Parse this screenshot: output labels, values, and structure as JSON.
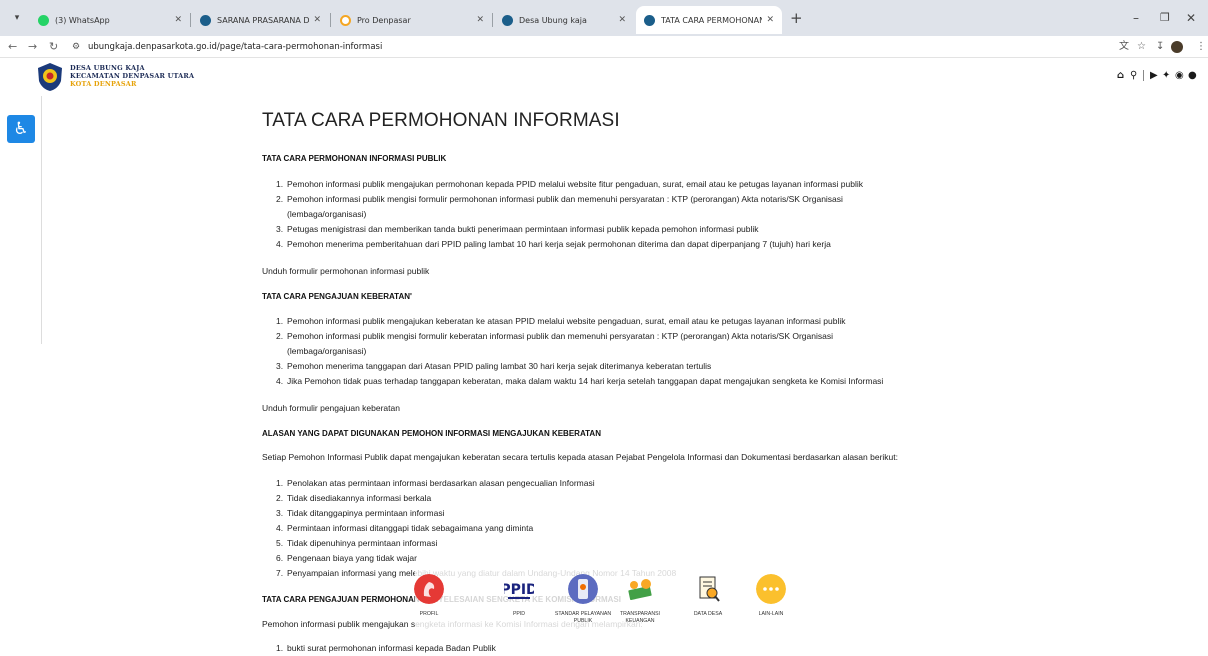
{
  "browser": {
    "tabs": [
      {
        "label": "(3) WhatsApp",
        "color": "#25d366"
      },
      {
        "label": "SARANA PRASARANA DAN INF",
        "color": "#1b5e8a"
      },
      {
        "label": "Pro Denpasar",
        "color": "#f5a623"
      },
      {
        "label": "Desa Ubung kaja",
        "color": "#1b5e8a"
      },
      {
        "label": "TATA CARA PERMOHONAN INF",
        "color": "#1b5e8a",
        "active": true
      }
    ],
    "new_tab": "+",
    "url": "ubungkaja.denpasarkota.go.id/page/tata-cara-permohonan-informasi"
  },
  "site": {
    "brand_line1": "DESA UBUNG KAJA",
    "brand_line2": "KECAMATAN DENPASAR UTARA",
    "brand_line3": "KOTA DENPASAR",
    "header_icons": [
      "home-icon",
      "search-icon",
      "youtube-icon",
      "twitter-icon",
      "instagram-icon",
      "facebook-icon"
    ]
  },
  "article": {
    "title": "TATA CARA PERMOHONAN INFORMASI",
    "section1": {
      "heading": "TATA CARA PERMOHONAN INFORMASI PUBLIK",
      "items": [
        "Pemohon informasi publik mengajukan permohonan kepada PPID melalui website fitur pengaduan, surat, email atau ke petugas layanan informasi publik",
        "Pemohon informasi publik mengisi formulir permohonan informasi publik dan memenuhi persyaratan : KTP (perorangan) Akta notaris/SK Organisasi",
        "Petugas menigistrasi dan memberikan tanda bukti penerimaan permintaan informasi publik kepada pemohon informasi publik",
        "Pemohon menerima pemberitahuan dari PPID paling lambat 10 hari kerja sejak permohonan diterima dan dapat diperpanjang 7 (tujuh) hari kerja"
      ],
      "item2_cont": "(lembaga/organisasi)",
      "download": "Unduh formulir permohonan informasi publik"
    },
    "section2": {
      "heading": "TATA CARA PENGAJUAN KEBERATAN'",
      "items": [
        "Pemohon informasi publik mengajukan keberatan ke atasan PPID melalui website pengaduan, surat, email atau ke petugas layanan informasi publik",
        "Pemohon informasi publik mengisi formulir keberatan informasi publik dan memenuhi persyaratan : KTP (perorangan) Akta notaris/SK Organisasi",
        "Pemohon menerima tanggapan dari Atasan PPID paling lambat 30 hari kerja sejak diterimanya keberatan tertulis",
        "Jika Pemohon tidak puas terhadap tanggapan keberatan, maka dalam waktu 14 hari kerja setelah tanggapan dapat mengajukan sengketa ke Komisi Informasi"
      ],
      "item2_cont": "(lembaga/organisasi)",
      "download": "Unduh formulir pengajuan keberatan"
    },
    "section3": {
      "heading": "ALASAN YANG DAPAT DIGUNAKAN PEMOHON INFORMASI MENGAJUKAN KEBERATAN",
      "intro": "Setiap Pemohon Informasi Publik dapat mengajukan keberatan secara tertulis kepada atasan Pejabat Pengelola Informasi dan Dokumentasi berdasarkan alasan berikut:",
      "items": [
        "Penolakan atas permintaan informasi berdasarkan alasan pengecualian Informasi",
        "Tidak disediakannya informasi berkala",
        "Tidak ditanggapinya permintaan informasi",
        "Permintaan informasi ditanggapi tidak sebagaimana yang diminta",
        "Tidak dipenuhinya permintaan informasi",
        "Pengenaan biaya yang tidak wajar",
        "Penyampaian informasi yang melebihi waktu yang diatur dalam Undang-Undang Nomor 14 Tahun 2008"
      ]
    },
    "section4": {
      "heading": "TATA CARA PENGAJUAN PERMOHONAN PENYELESAIAN SENGKETA KE KOMISI INFORMASI",
      "intro": "Pemohon informasi publik mengajukan sengketa informasi ke Komisi Informasi dengan melampirkan:",
      "items": [
        "bukti surat permohonan informasi kepada Badan Publik"
      ]
    }
  },
  "quick_menu": [
    {
      "label": "PROFIL",
      "icon": "profile-icon",
      "color": "#e53935"
    },
    {
      "label": "PPID",
      "icon": "ppid-icon",
      "color": "#1a237e"
    },
    {
      "label": "STANDAR PELAYANAN PUBLIK",
      "icon": "phone-service-icon",
      "color": "#5c6bc0"
    },
    {
      "label": "TRANSPARANSI KEUANGAN",
      "icon": "money-icon",
      "color": "#43a047"
    },
    {
      "label": "DATA DESA",
      "icon": "data-document-icon",
      "color": "#f9a825"
    },
    {
      "label": "LAIN-LAIN",
      "icon": "more-icon",
      "color": "#fbc02d"
    }
  ]
}
